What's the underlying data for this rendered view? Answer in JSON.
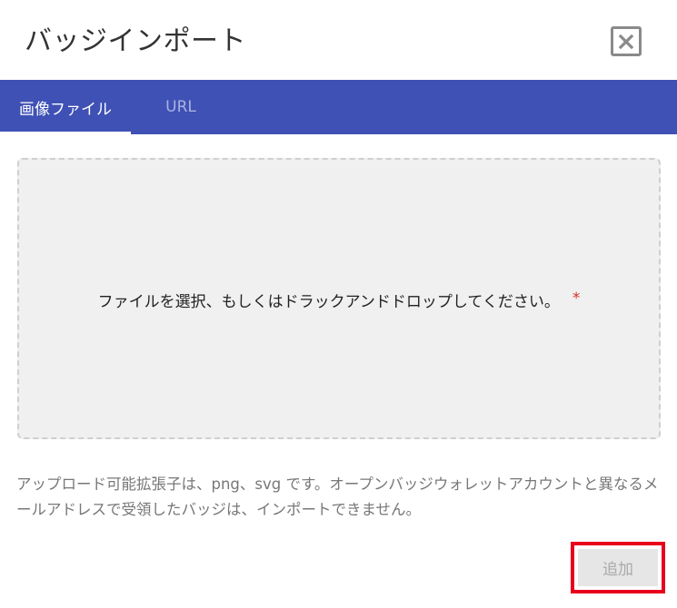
{
  "dialog": {
    "title": "バッジインポート",
    "close_icon": "close-icon"
  },
  "tabs": [
    {
      "label": "画像ファイル",
      "active": true
    },
    {
      "label": "URL",
      "active": false
    }
  ],
  "dropzone": {
    "text": "ファイルを選択、もしくはドラックアンドドロップしてください。",
    "required_mark": "*"
  },
  "help_text": "アップロード可能拡張子は、png、svg です。オープンバッジウォレットアカウントと異なるメールアドレスで受領したバッジは、インポートできません。",
  "actions": {
    "add_label": "追加",
    "add_enabled": false
  },
  "colors": {
    "tabbar": "#3f51b5",
    "highlight_border": "#e8001c",
    "required": "#d93025"
  }
}
